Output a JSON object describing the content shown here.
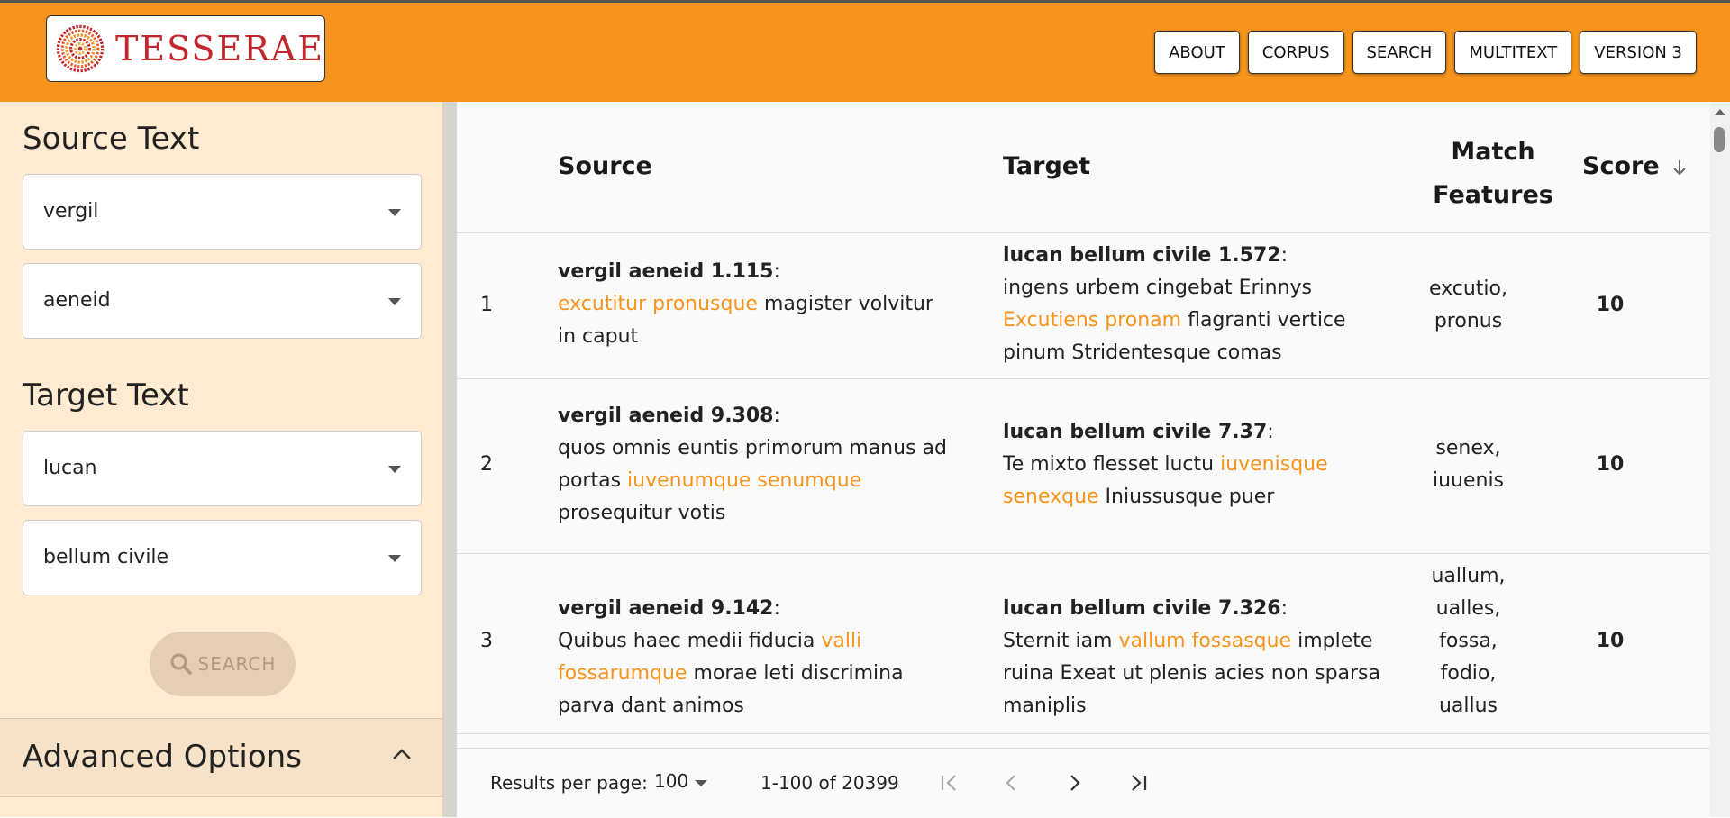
{
  "header": {
    "logo_text": "TESSERAE",
    "nav": [
      "ABOUT",
      "CORPUS",
      "SEARCH",
      "MULTITEXT",
      "VERSION 3"
    ],
    "brand_color": "#f7941d"
  },
  "sidebar": {
    "source_title": "Source Text",
    "source_author": "vergil",
    "source_work": "aeneid",
    "target_title": "Target Text",
    "target_author": "lucan",
    "target_work": "bellum civile",
    "search_label": "SEARCH",
    "advanced_label": "Advanced Options"
  },
  "table": {
    "headers": {
      "source": "Source",
      "target": "Target",
      "features_line1": "Match",
      "features_line2": "Features",
      "score": "Score"
    },
    "rows": [
      {
        "index": "1",
        "source_cite": "vergil aeneid 1.115",
        "source_parts": [
          {
            "t": "excutitur pronusque",
            "hl": true
          },
          {
            "t": " magister volvitur in caput",
            "hl": false
          }
        ],
        "target_cite": "lucan bellum civile 1.572",
        "target_parts": [
          {
            "t": "ingens urbem cingebat Erinnys ",
            "hl": false
          },
          {
            "t": "Excutiens pronam",
            "hl": true
          },
          {
            "t": " flagranti vertice pinum Stridentesque comas",
            "hl": false
          }
        ],
        "features": [
          "excutio,",
          "pronus"
        ],
        "score": "10"
      },
      {
        "index": "2",
        "source_cite": "vergil aeneid 9.308",
        "source_parts": [
          {
            "t": "quos omnis euntis primorum manus ad portas ",
            "hl": false
          },
          {
            "t": "iuvenumque senumque",
            "hl": true
          },
          {
            "t": " prosequitur votis",
            "hl": false
          }
        ],
        "target_cite": "lucan bellum civile 7.37",
        "target_parts": [
          {
            "t": "Te mixto flesset luctu ",
            "hl": false
          },
          {
            "t": "iuvenisque senexque",
            "hl": true
          },
          {
            "t": " Iniussusque puer",
            "hl": false
          }
        ],
        "features": [
          "senex,",
          "iuuenis"
        ],
        "score": "10"
      },
      {
        "index": "3",
        "source_cite": "vergil aeneid 9.142",
        "source_parts": [
          {
            "t": "Quibus haec medii fiducia ",
            "hl": false
          },
          {
            "t": "valli fossarumque",
            "hl": true
          },
          {
            "t": " morae leti discrimina parva dant animos",
            "hl": false
          }
        ],
        "target_cite": "lucan bellum civile 7.326",
        "target_parts": [
          {
            "t": "Sternit iam ",
            "hl": false
          },
          {
            "t": "vallum fossasque",
            "hl": true
          },
          {
            "t": " implete ruina Exeat ut plenis acies non sparsa maniplis",
            "hl": false
          }
        ],
        "features": [
          "uallum,",
          "ualles,",
          "fossa,",
          "fodio,",
          "uallus"
        ],
        "score": "10"
      }
    ]
  },
  "footer": {
    "per_page_label": "Results per page:",
    "per_page_value": "100",
    "range": "1-100 of 20399"
  }
}
